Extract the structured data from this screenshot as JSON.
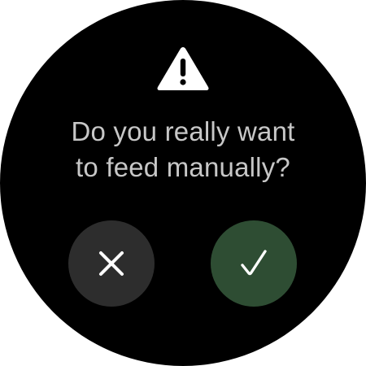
{
  "dialog": {
    "icon": "warning-triangle-icon",
    "message_line1": "Do you really want",
    "message_line2": "to feed manually?"
  },
  "actions": {
    "cancel_icon": "close-icon",
    "confirm_icon": "checkmark-icon"
  },
  "colors": {
    "background": "#000000",
    "text": "#c7c7c7",
    "cancel_button": "#2d2d2d",
    "confirm_button": "#2e4d33",
    "icon": "#ffffff"
  }
}
